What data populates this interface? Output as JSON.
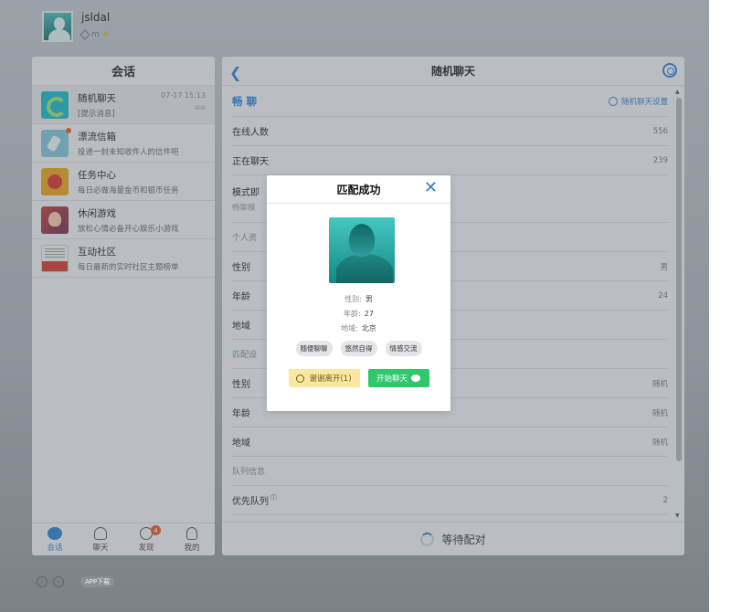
{
  "user": {
    "name": "jsldal",
    "level": "m"
  },
  "left_panel": {
    "title": "会话",
    "conversations": [
      {
        "title": "随机聊天",
        "subtitle": "[提示消息]",
        "time": "07-17 15:13",
        "mini": "⊙⊙"
      },
      {
        "title": "漂流信箱",
        "subtitle": "投递一封未知收件人的信件吧",
        "time": "",
        "mini": ""
      },
      {
        "title": "任务中心",
        "subtitle": "每日必做海量金币和银币任务",
        "time": "",
        "mini": ""
      },
      {
        "title": "休闲游戏",
        "subtitle": "放松心情必备开心娱乐小游戏",
        "time": "",
        "mini": ""
      },
      {
        "title": "互动社区",
        "subtitle": "每日最新的实时社区主题榜单",
        "time": "",
        "mini": ""
      }
    ],
    "nav": [
      {
        "label": "会话"
      },
      {
        "label": "聊天"
      },
      {
        "label": "发现",
        "badge": "4"
      },
      {
        "label": "我的"
      }
    ]
  },
  "main_panel": {
    "title": "随机聊天",
    "section_title": "畅 聊",
    "settings_link": "随机聊天设置",
    "rows": [
      {
        "label": "在线人数",
        "value": "556"
      },
      {
        "label": "正在聊天",
        "value": "239"
      }
    ],
    "mode": {
      "label": "模式即",
      "sub": "畅聊模"
    },
    "personal_label": "个人资",
    "personal_rows": [
      {
        "label": "性别",
        "value": "男"
      },
      {
        "label": "年龄",
        "value": "24"
      },
      {
        "label": "地域",
        "value": ""
      }
    ],
    "match_label": "匹配设",
    "match_rows": [
      {
        "label": "性别",
        "value": "随机"
      },
      {
        "label": "年龄",
        "value": "随机"
      },
      {
        "label": "地域",
        "value": "随机"
      }
    ],
    "queue_label": "队列信息",
    "queue_rows": [
      {
        "label": "优先队列",
        "info": "ⓘ",
        "value": "2"
      }
    ],
    "footer": "等待配对"
  },
  "modal": {
    "title": "匹配成功",
    "close": "✕",
    "gender_label": "性别:",
    "gender": "男",
    "age_label": "年龄:",
    "age": "27",
    "region_label": "地域:",
    "region": "北京",
    "tags": [
      "随便聊聊",
      "悠然自得",
      "情感交流"
    ],
    "leave_button": "谢谢离开(1)",
    "start_button": "开始聊天"
  },
  "bottom": {
    "app_download": "APP下载"
  }
}
